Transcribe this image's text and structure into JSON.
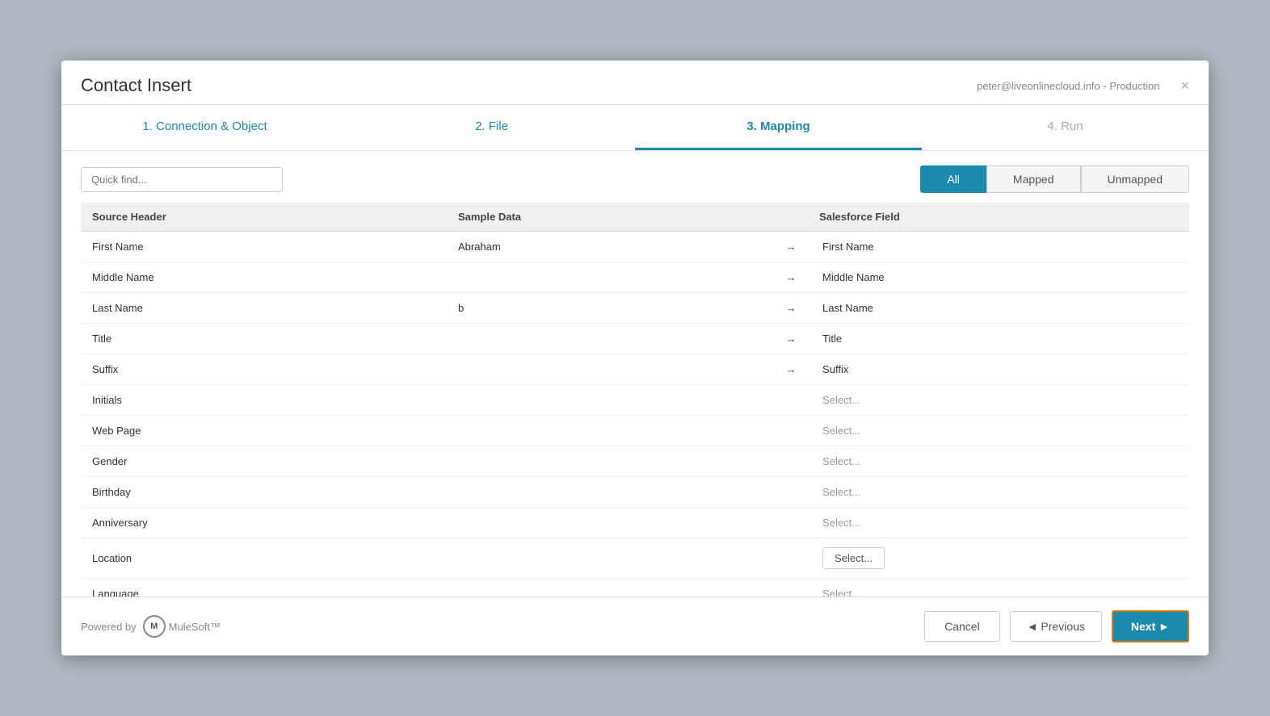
{
  "modal": {
    "title": "Contact Insert",
    "user": "peter@liveonlinecloud.info - Production",
    "close_label": "×"
  },
  "steps": [
    {
      "id": "step1",
      "label": "1. Connection & Object",
      "state": "completed"
    },
    {
      "id": "step2",
      "label": "2. File",
      "state": "completed"
    },
    {
      "id": "step3",
      "label": "3. Mapping",
      "state": "active"
    },
    {
      "id": "step4",
      "label": "4. Run",
      "state": "inactive"
    }
  ],
  "filter": {
    "quick_find_placeholder": "Quick find...",
    "buttons": [
      {
        "id": "all",
        "label": "All",
        "active": true
      },
      {
        "id": "mapped",
        "label": "Mapped",
        "active": false
      },
      {
        "id": "unmapped",
        "label": "Unmapped",
        "active": false
      }
    ]
  },
  "table": {
    "headers": {
      "source": "Source Header",
      "sample": "Sample Data",
      "salesforce": "Salesforce Field"
    },
    "rows": [
      {
        "source": "First Name",
        "sample": "Abraham",
        "arrow": "→",
        "sf_field": "First Name",
        "mapped": true
      },
      {
        "source": "Middle Name",
        "sample": "",
        "arrow": "→",
        "sf_field": "Middle Name",
        "mapped": true
      },
      {
        "source": "Last Name",
        "sample": "b",
        "arrow": "→",
        "sf_field": "Last Name",
        "mapped": true
      },
      {
        "source": "Title",
        "sample": "",
        "arrow": "→",
        "sf_field": "Title",
        "mapped": true
      },
      {
        "source": "Suffix",
        "sample": "",
        "arrow": "→",
        "sf_field": "Suffix",
        "mapped": true
      },
      {
        "source": "Initials",
        "sample": "",
        "arrow": "",
        "sf_field": "Select...",
        "mapped": false
      },
      {
        "source": "Web Page",
        "sample": "",
        "arrow": "",
        "sf_field": "Select...",
        "mapped": false
      },
      {
        "source": "Gender",
        "sample": "",
        "arrow": "",
        "sf_field": "Select...",
        "mapped": false
      },
      {
        "source": "Birthday",
        "sample": "",
        "arrow": "",
        "sf_field": "Select...",
        "mapped": false
      },
      {
        "source": "Anniversary",
        "sample": "",
        "arrow": "",
        "sf_field": "Select...",
        "mapped": false
      },
      {
        "source": "Location",
        "sample": "",
        "arrow": "",
        "sf_field": "Select...",
        "mapped": false,
        "highlighted": true
      },
      {
        "source": "Language",
        "sample": "",
        "arrow": "",
        "sf_field": "Select...",
        "mapped": false
      }
    ]
  },
  "footer": {
    "powered_by": "Powered by",
    "brand": "MuleSoft™",
    "cancel_label": "Cancel",
    "previous_label": "◄ Previous",
    "next_label": "Next ►"
  }
}
